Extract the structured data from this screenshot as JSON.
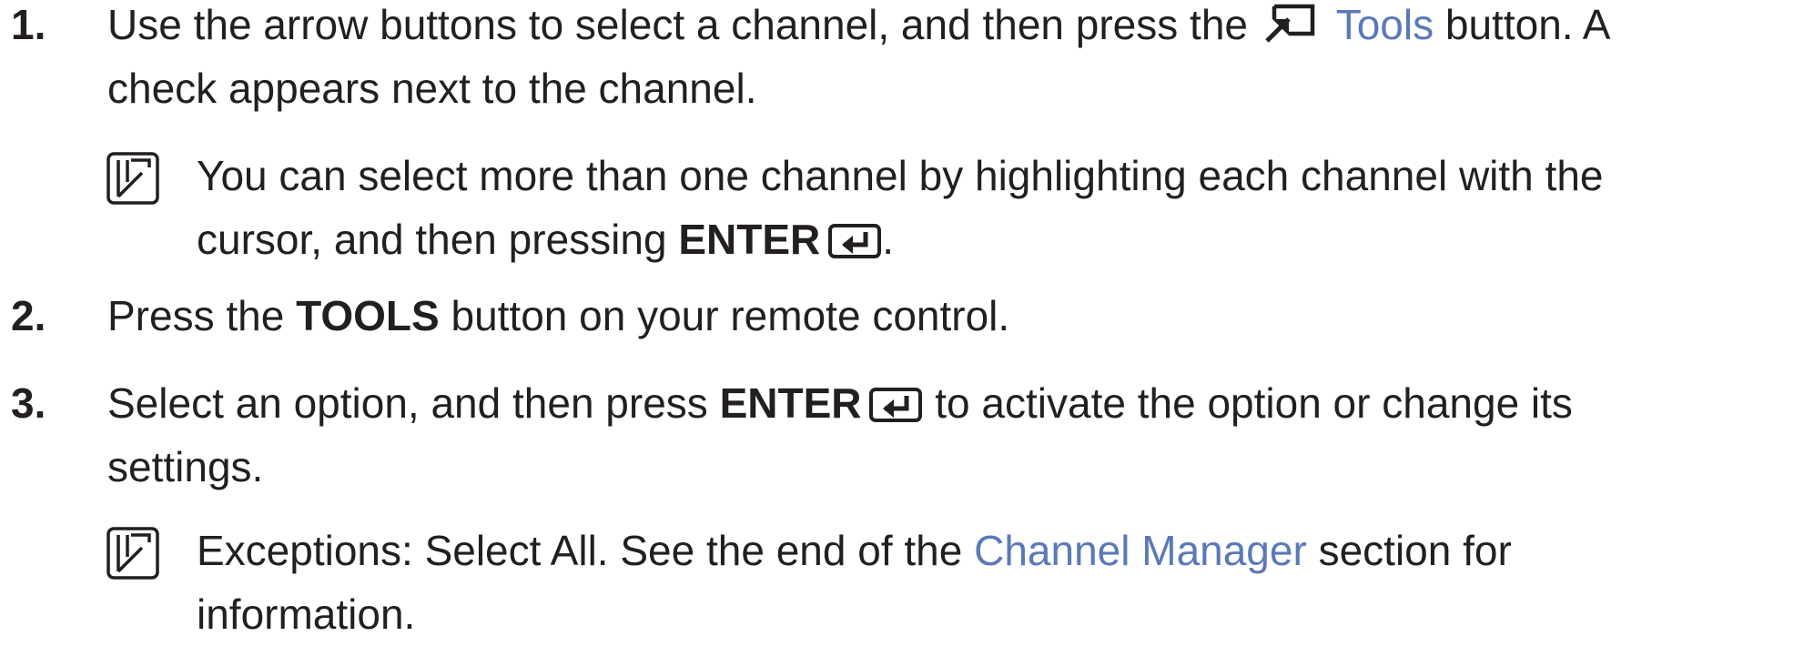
{
  "steps": [
    {
      "number": "1.",
      "text_before": "Use the arrow buttons to select a channel, and then press the",
      "tools_label": "Tools",
      "text_after_line1": "button. A",
      "text_line2": "check appears next to the channel.",
      "note": {
        "text_before": "You can select more than one channel by highlighting each channel with the",
        "text_line2_before": "cursor, and then pressing",
        "enter_label": "ENTER",
        "text_end": "."
      }
    },
    {
      "number": "2.",
      "text_before": "Press the",
      "bold_label": "TOOLS",
      "text_after": "button on your remote control."
    },
    {
      "number": "3.",
      "text_before": "Select an option, and then press",
      "enter_label": "ENTER",
      "text_after_line1": "to activate the option or change its",
      "text_line2": "settings.",
      "note": {
        "text_before": "Exceptions: Select All. See the end of the",
        "link_label": "Channel Manager",
        "text_after": "section for",
        "text_line2": "information."
      }
    }
  ],
  "icons": {
    "tools": "tools-icon",
    "enter": "enter-icon",
    "memo": "memo-icon"
  },
  "colors": {
    "text": "#231f20",
    "link": "#5a79b8"
  }
}
